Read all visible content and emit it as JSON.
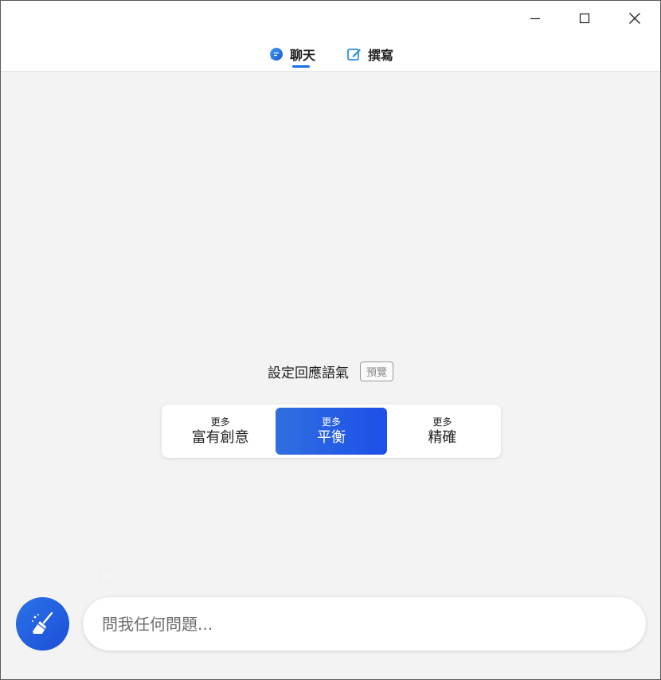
{
  "window": {
    "controls": [
      "minimize",
      "maximize",
      "close"
    ]
  },
  "tabs": [
    {
      "label": "聊天",
      "icon": "chat-bubble-icon",
      "active": true
    },
    {
      "label": "撰寫",
      "icon": "edit-icon",
      "active": false
    }
  ],
  "tone": {
    "label": "設定回應語氣",
    "preview_badge": "預覽",
    "options": [
      {
        "small": "更多",
        "big": "富有創意",
        "active": false
      },
      {
        "small": "更多",
        "big": "平衡",
        "active": true
      },
      {
        "small": "更多",
        "big": "精確",
        "active": false
      }
    ]
  },
  "composer": {
    "placeholder": "問我任何問題...",
    "value": "",
    "new_topic_icon": "broom-icon"
  },
  "colors": {
    "accent": "#1a6fe8",
    "active_gradient_start": "#2f6fe0",
    "active_gradient_end": "#1d4fe8",
    "background": "#f3f3f3"
  }
}
